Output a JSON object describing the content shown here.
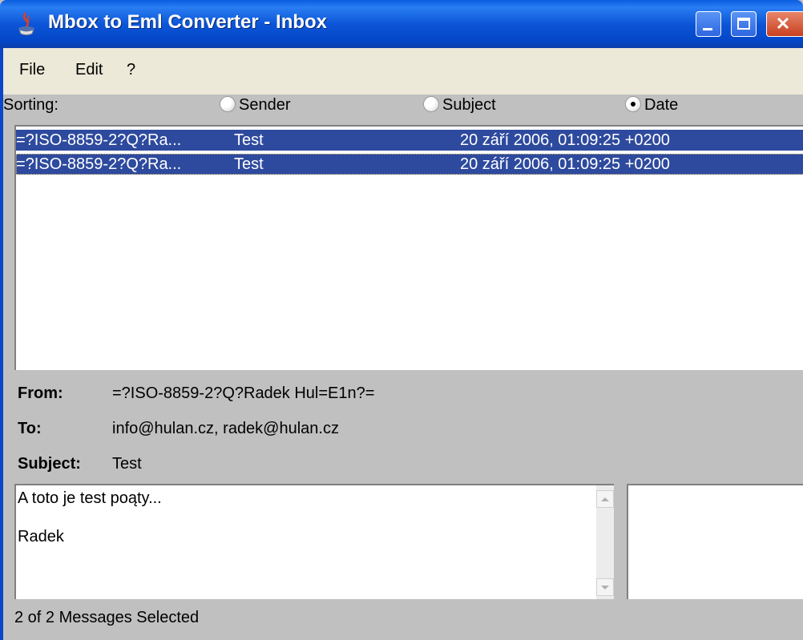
{
  "window": {
    "title": "Mbox to Eml Converter - Inbox",
    "controls": {
      "minimize": "minimize",
      "maximize": "maximize",
      "close": "close"
    }
  },
  "menu": {
    "items": [
      "File",
      "Edit",
      "?"
    ]
  },
  "sorting": {
    "label": "Sorting:",
    "options": [
      "Sender",
      "Subject",
      "Date"
    ],
    "selected": "Date"
  },
  "messages": [
    {
      "sender": "=?ISO-8859-2?Q?Ra...",
      "subject": "Test",
      "date": "20 září 2006, 01:09:25 +0200"
    },
    {
      "sender": "=?ISO-8859-2?Q?Ra...",
      "subject": "Test",
      "date": "20 září 2006, 01:09:25 +0200"
    }
  ],
  "details": {
    "from_label": "From:",
    "from_value": "=?ISO-8859-2?Q?Radek Hul=E1n?=",
    "to_label": "To:",
    "to_value": "info@hulan.cz, radek@hulan.cz",
    "subject_label": "Subject:",
    "subject_value": "Test"
  },
  "body": {
    "line1": "A toto je test poąty...",
    "line2": "Radek"
  },
  "status": "2 of 2 Messages Selected",
  "colors": {
    "title_bar": "#0a5ce0",
    "selection": "#2e4a9e",
    "panel": "#c0c0c0",
    "menu_bg": "#ece9d8"
  }
}
